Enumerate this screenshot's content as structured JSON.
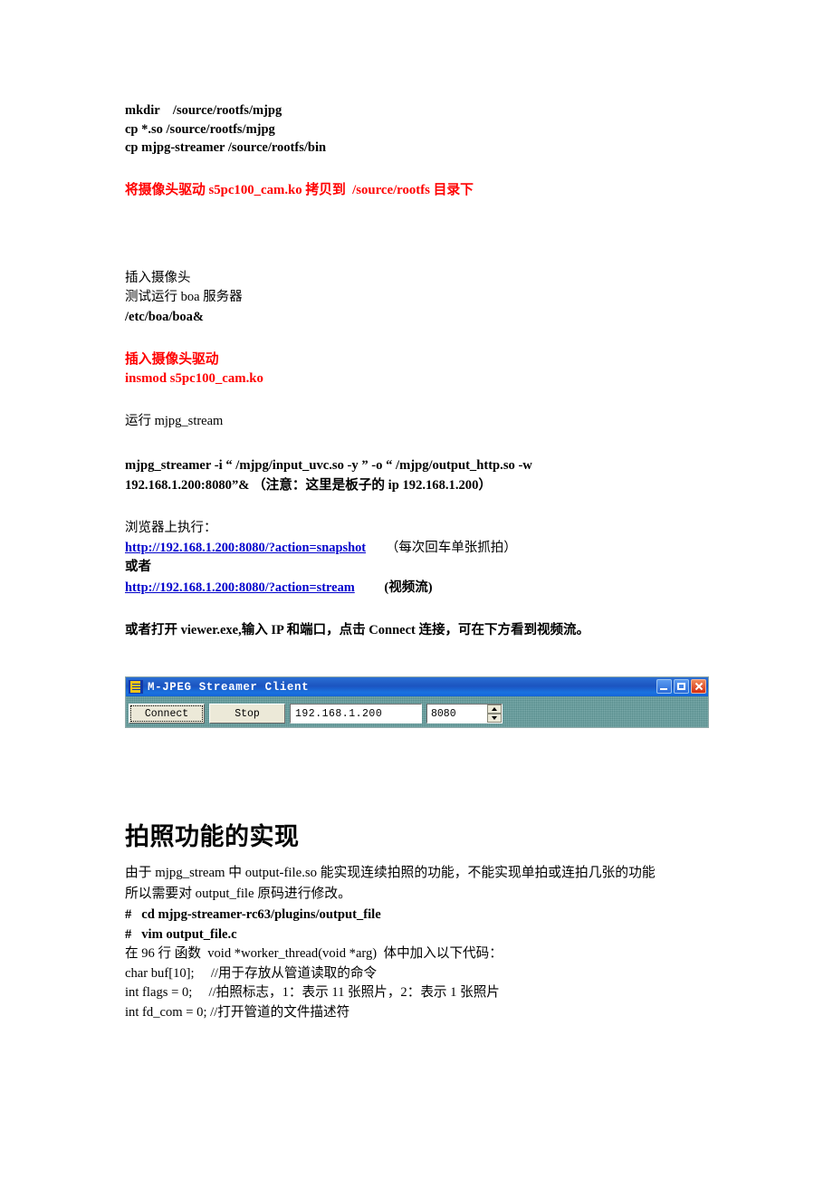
{
  "document": {
    "commands_top": [
      "mkdir    /source/rootfs/mjpg",
      "cp *.so /source/rootfs/mjpg",
      "cp mjpg-streamer /source/rootfs/bin"
    ],
    "red_note_1": "将摄像头驱动 s5pc100_cam.ko 拷贝到  /source/rootfs 目录下",
    "boa_block": [
      "插入摄像头",
      "测试运行 boa 服务器"
    ],
    "boa_command": "/etc/boa/boa&",
    "red_note_2": "插入摄像头驱动",
    "red_command_2": "insmod s5pc100_cam.ko",
    "run_label": "运行 mjpg_stream",
    "streamer_command_line1": "mjpg_streamer      -i   “ /mjpg/input_uvc.so  -y ”     -o   “ /mjpg/output_http.so      -w",
    "streamer_command_line2": "192.168.1.200:8080”&      （注意：这里是板子的 ip 192.168.1.200）",
    "browser_label": "浏览器上执行：",
    "link_snapshot": "http://192.168.1.200:8080/?action=snapshot",
    "link_snapshot_note": "（每次回车单张抓拍）",
    "or_label": "或者",
    "link_stream": "http://192.168.1.200:8080/?action=stream",
    "link_stream_note": "(视频流)",
    "viewer_instruction": "或者打开 viewer.exe,输入 IP 和端口，点击 Connect 连接，可在下方看到视频流。"
  },
  "app_window": {
    "title": "M-JPEG Streamer Client",
    "icon": "film-strip-icon",
    "buttons": {
      "connect": "Connect",
      "stop": "Stop"
    },
    "ip_value": "192.168.1.200",
    "port_value": "8080",
    "window_controls": {
      "minimize": "minimize-icon",
      "maximize": "maximize-icon",
      "close": "close-icon"
    },
    "colors": {
      "titlebar": "#1c54c0",
      "body": "#5f9a9a",
      "close_button": "#d42b10"
    }
  },
  "section2": {
    "heading": "拍照功能的实现",
    "paragraph_line1": "由于 mjpg_stream 中 output-file.so 能实现连续拍照的功能，不能实现单拍或连拍几张的功能",
    "paragraph_line2": "所以需要对 output_file 原码进行修改。",
    "code_lines": [
      "#   cd mjpg-streamer-rc63/plugins/output_file",
      "#   vim output_file.c",
      "在 96 行 函数  void *worker_thread(void *arg)  体中加入以下代码：",
      "char buf[10];     //用于存放从管道读取的命令",
      "int flags = 0;     //拍照标志，1：表示 11 张照片，2：表示 1 张照片",
      "int fd_com = 0; //打开管道的文件描述符"
    ]
  },
  "theme": {
    "link_color": "#0000cc",
    "red_color": "#ff0000"
  }
}
